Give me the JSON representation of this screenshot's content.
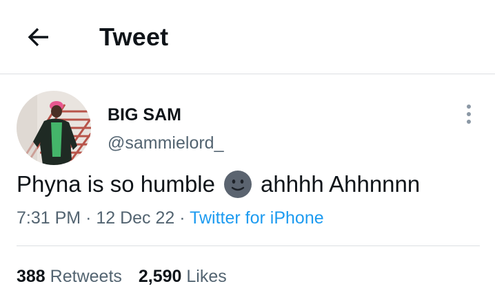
{
  "header": {
    "title": "Tweet",
    "back_icon": "arrow-left-icon"
  },
  "tweet": {
    "author": {
      "display_name": "BIG SAM",
      "handle": "@sammielord_",
      "avatar_icon": "profile-photo"
    },
    "more_icon": "more-vertical-icon",
    "text_before": "Phyna is so humble",
    "emoji": "slightly-smiling-face-emoji",
    "text_after": "ahhhh Ahhnnnn",
    "time": "7:31 PM",
    "separator": "·",
    "date": "12 Dec 22",
    "source": "Twitter for iPhone"
  },
  "stats": {
    "retweets_count": "388",
    "retweets_label": "Retweets",
    "likes_count": "2,590",
    "likes_label": "Likes"
  },
  "colors": {
    "text": "#0f1419",
    "secondary": "#536471",
    "link": "#1d9bf0",
    "divider": "#dcdfe2",
    "emoji_face": "#5b6470"
  }
}
